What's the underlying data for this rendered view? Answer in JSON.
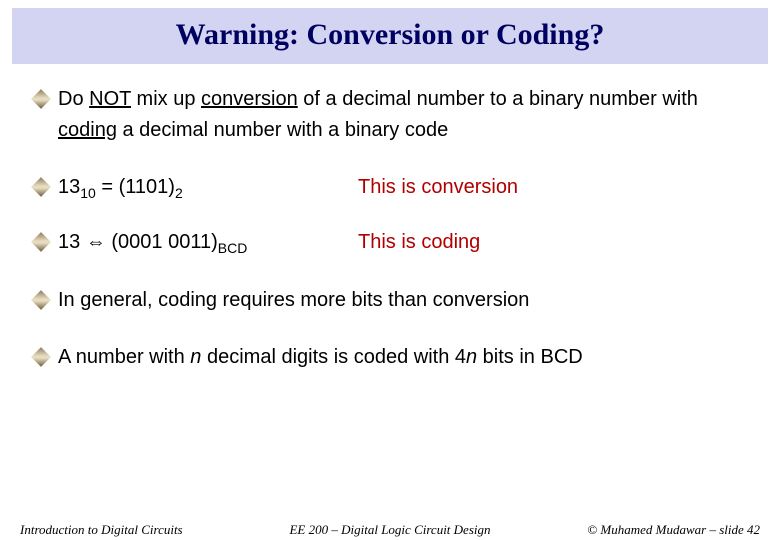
{
  "title": "Warning: Conversion or Coding?",
  "bullets": {
    "b1_pre": "Do ",
    "b1_not": "NOT",
    "b1_mid1": " mix up ",
    "b1_conv": "conversion",
    "b1_mid2": " of a decimal number to a binary number with ",
    "b1_coding": "coding",
    "b1_post": " a decimal number with a binary code",
    "b2_lhs_a": "13",
    "b2_lhs_sub": "10",
    "b2_lhs_b": " = (1101)",
    "b2_lhs_sub2": "2",
    "b2_rhs": "This is conversion",
    "b3_lhs_a": "13 ",
    "b3_arrow": "⇔",
    "b3_lhs_b": " (0001 0011)",
    "b3_lhs_sub": "BCD",
    "b3_rhs": "This is coding",
    "b4": "In general, coding requires more bits than conversion",
    "b5_pre": "A number with ",
    "b5_n1": "n",
    "b5_mid": " decimal digits is coded with 4",
    "b5_n2": "n",
    "b5_post": " bits in BCD"
  },
  "footer": {
    "left": "Introduction to Digital Circuits",
    "mid": "EE 200 – Digital Logic Circuit Design",
    "right": "© Muhamed Mudawar – slide 42"
  }
}
